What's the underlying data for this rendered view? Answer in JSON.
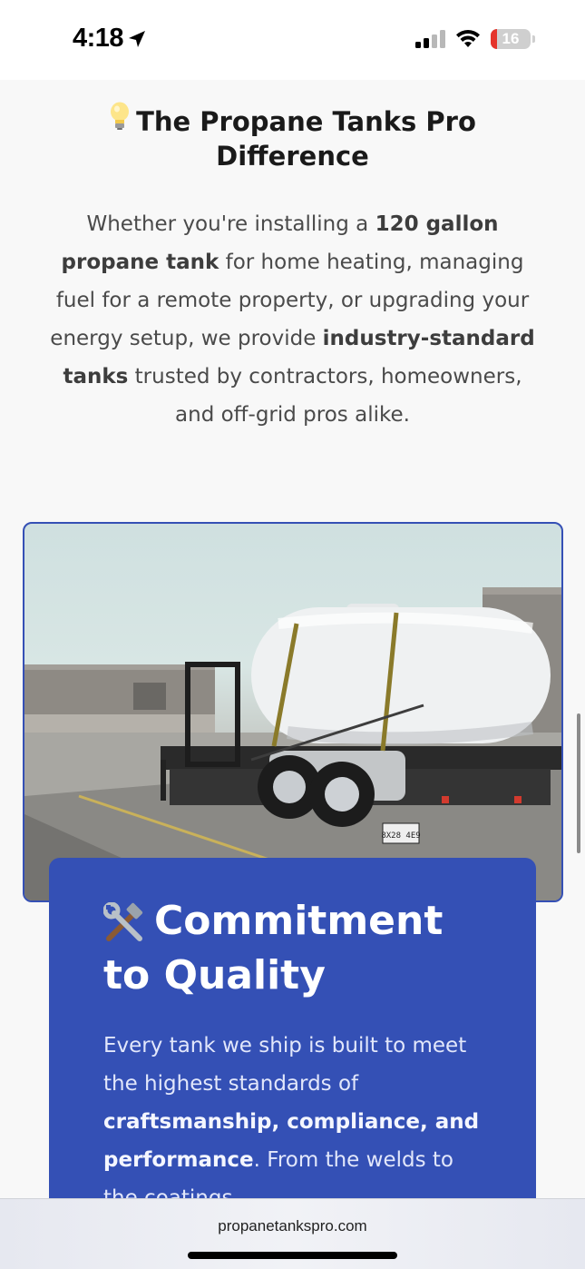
{
  "status": {
    "time": "4:18",
    "battery_text": "16",
    "battery_level": 0.16,
    "signal_bars_active": 2
  },
  "section": {
    "icon": "light-bulb-icon",
    "title": "The Propane Tanks Pro Difference",
    "intro_parts": [
      "Whether you're installing a ",
      "120 gallon propane tank",
      " for home heating, managing fuel for a remote property, or upgrading your energy setup, we provide ",
      "industry-standard tanks",
      " trusted by contractors, homeowners, and off-grid pros alike."
    ]
  },
  "photo": {
    "subject": "white propane tank strapped on a flatbed trailer",
    "plate_text": "8X28 4E9"
  },
  "card": {
    "icon": "hammer-wrench-icon",
    "title": "Commitment to Quality",
    "body_parts": [
      "Every tank we ship is built to meet the highest standards of ",
      "craftsmanship, compliance, and performance",
      ". From the welds to the coatings"
    ]
  },
  "browser": {
    "url": "propanetankspro.com"
  },
  "colors": {
    "accent": "#3450b5",
    "background": "#f8f8f8",
    "battery_red": "#e5342b"
  }
}
